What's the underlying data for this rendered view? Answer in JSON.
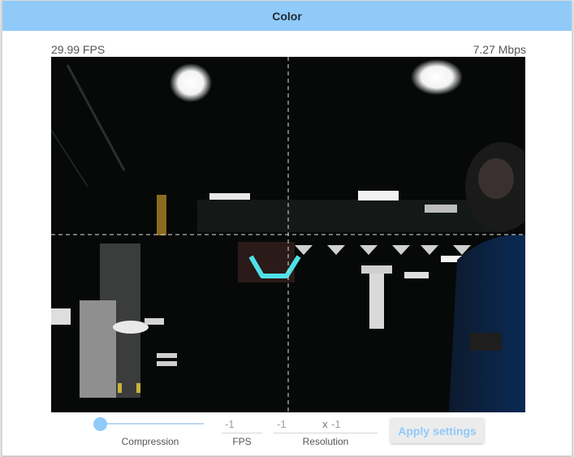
{
  "panel": {
    "title": "Color"
  },
  "stats": {
    "fps": "29.99 FPS",
    "bitrate": "7.27 Mbps"
  },
  "settings": {
    "compression": {
      "label": "Compression",
      "value": 0
    },
    "fps": {
      "value": "-1",
      "label": "FPS"
    },
    "resolution": {
      "width": "-1",
      "separator": "x",
      "height": "-1",
      "label": "Resolution"
    },
    "apply_label": "Apply settings"
  },
  "colors": {
    "title_bar": "#90caf9",
    "accent": "#90caf9",
    "crosshair": "#e0e0e0",
    "target_highlight": "#4fe0e8"
  }
}
